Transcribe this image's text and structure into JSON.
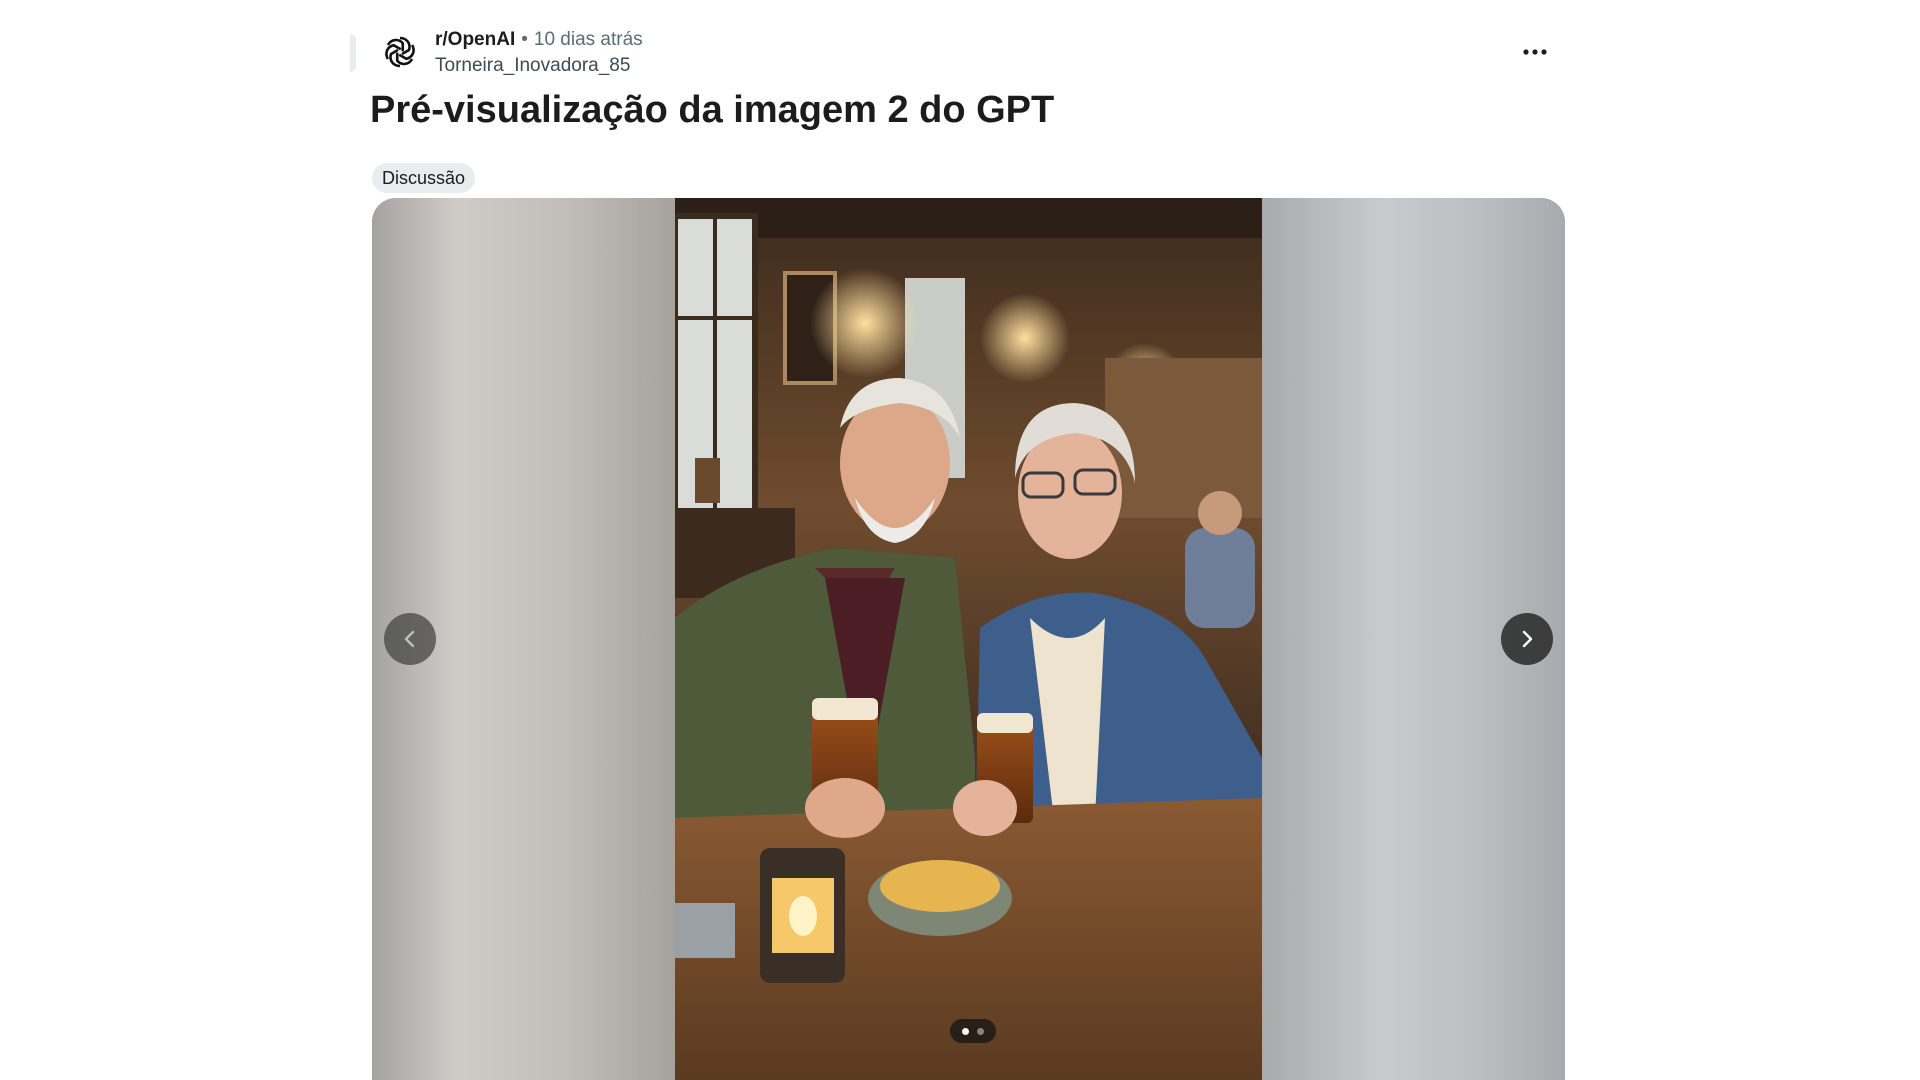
{
  "post": {
    "subreddit": "r/OpenAI",
    "separator": "•",
    "time": "10 dias atrás",
    "author": "Torneira_Inovadora_85",
    "overflow_label": "•••",
    "title": "Pré-visualização da imagem 2 do GPT",
    "flair": "Discussão"
  },
  "gallery": {
    "current_index": 1,
    "total": 2,
    "image_description": "Idosos sorridentes brindando com cerveja em um pub",
    "prev_icon": "chevron-left-icon",
    "next_icon": "chevron-right-icon"
  },
  "colors": {
    "text": "#1c1c1c",
    "muted": "#5c6c74",
    "flair_bg": "#eaedef",
    "nav_bg": "#333333"
  }
}
